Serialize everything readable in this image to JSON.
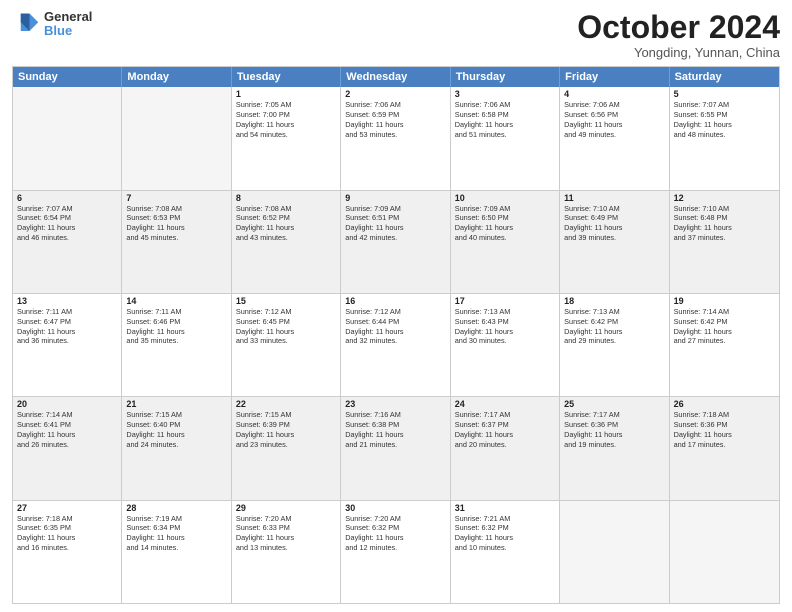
{
  "header": {
    "logo_line1": "General",
    "logo_line2": "Blue",
    "month": "October 2024",
    "location": "Yongding, Yunnan, China"
  },
  "weekdays": [
    "Sunday",
    "Monday",
    "Tuesday",
    "Wednesday",
    "Thursday",
    "Friday",
    "Saturday"
  ],
  "rows": [
    [
      {
        "day": "",
        "info": ""
      },
      {
        "day": "",
        "info": ""
      },
      {
        "day": "1",
        "info": "Sunrise: 7:05 AM\nSunset: 7:00 PM\nDaylight: 11 hours\nand 54 minutes."
      },
      {
        "day": "2",
        "info": "Sunrise: 7:06 AM\nSunset: 6:59 PM\nDaylight: 11 hours\nand 53 minutes."
      },
      {
        "day": "3",
        "info": "Sunrise: 7:06 AM\nSunset: 6:58 PM\nDaylight: 11 hours\nand 51 minutes."
      },
      {
        "day": "4",
        "info": "Sunrise: 7:06 AM\nSunset: 6:56 PM\nDaylight: 11 hours\nand 49 minutes."
      },
      {
        "day": "5",
        "info": "Sunrise: 7:07 AM\nSunset: 6:55 PM\nDaylight: 11 hours\nand 48 minutes."
      }
    ],
    [
      {
        "day": "6",
        "info": "Sunrise: 7:07 AM\nSunset: 6:54 PM\nDaylight: 11 hours\nand 46 minutes."
      },
      {
        "day": "7",
        "info": "Sunrise: 7:08 AM\nSunset: 6:53 PM\nDaylight: 11 hours\nand 45 minutes."
      },
      {
        "day": "8",
        "info": "Sunrise: 7:08 AM\nSunset: 6:52 PM\nDaylight: 11 hours\nand 43 minutes."
      },
      {
        "day": "9",
        "info": "Sunrise: 7:09 AM\nSunset: 6:51 PM\nDaylight: 11 hours\nand 42 minutes."
      },
      {
        "day": "10",
        "info": "Sunrise: 7:09 AM\nSunset: 6:50 PM\nDaylight: 11 hours\nand 40 minutes."
      },
      {
        "day": "11",
        "info": "Sunrise: 7:10 AM\nSunset: 6:49 PM\nDaylight: 11 hours\nand 39 minutes."
      },
      {
        "day": "12",
        "info": "Sunrise: 7:10 AM\nSunset: 6:48 PM\nDaylight: 11 hours\nand 37 minutes."
      }
    ],
    [
      {
        "day": "13",
        "info": "Sunrise: 7:11 AM\nSunset: 6:47 PM\nDaylight: 11 hours\nand 36 minutes."
      },
      {
        "day": "14",
        "info": "Sunrise: 7:11 AM\nSunset: 6:46 PM\nDaylight: 11 hours\nand 35 minutes."
      },
      {
        "day": "15",
        "info": "Sunrise: 7:12 AM\nSunset: 6:45 PM\nDaylight: 11 hours\nand 33 minutes."
      },
      {
        "day": "16",
        "info": "Sunrise: 7:12 AM\nSunset: 6:44 PM\nDaylight: 11 hours\nand 32 minutes."
      },
      {
        "day": "17",
        "info": "Sunrise: 7:13 AM\nSunset: 6:43 PM\nDaylight: 11 hours\nand 30 minutes."
      },
      {
        "day": "18",
        "info": "Sunrise: 7:13 AM\nSunset: 6:42 PM\nDaylight: 11 hours\nand 29 minutes."
      },
      {
        "day": "19",
        "info": "Sunrise: 7:14 AM\nSunset: 6:42 PM\nDaylight: 11 hours\nand 27 minutes."
      }
    ],
    [
      {
        "day": "20",
        "info": "Sunrise: 7:14 AM\nSunset: 6:41 PM\nDaylight: 11 hours\nand 26 minutes."
      },
      {
        "day": "21",
        "info": "Sunrise: 7:15 AM\nSunset: 6:40 PM\nDaylight: 11 hours\nand 24 minutes."
      },
      {
        "day": "22",
        "info": "Sunrise: 7:15 AM\nSunset: 6:39 PM\nDaylight: 11 hours\nand 23 minutes."
      },
      {
        "day": "23",
        "info": "Sunrise: 7:16 AM\nSunset: 6:38 PM\nDaylight: 11 hours\nand 21 minutes."
      },
      {
        "day": "24",
        "info": "Sunrise: 7:17 AM\nSunset: 6:37 PM\nDaylight: 11 hours\nand 20 minutes."
      },
      {
        "day": "25",
        "info": "Sunrise: 7:17 AM\nSunset: 6:36 PM\nDaylight: 11 hours\nand 19 minutes."
      },
      {
        "day": "26",
        "info": "Sunrise: 7:18 AM\nSunset: 6:36 PM\nDaylight: 11 hours\nand 17 minutes."
      }
    ],
    [
      {
        "day": "27",
        "info": "Sunrise: 7:18 AM\nSunset: 6:35 PM\nDaylight: 11 hours\nand 16 minutes."
      },
      {
        "day": "28",
        "info": "Sunrise: 7:19 AM\nSunset: 6:34 PM\nDaylight: 11 hours\nand 14 minutes."
      },
      {
        "day": "29",
        "info": "Sunrise: 7:20 AM\nSunset: 6:33 PM\nDaylight: 11 hours\nand 13 minutes."
      },
      {
        "day": "30",
        "info": "Sunrise: 7:20 AM\nSunset: 6:32 PM\nDaylight: 11 hours\nand 12 minutes."
      },
      {
        "day": "31",
        "info": "Sunrise: 7:21 AM\nSunset: 6:32 PM\nDaylight: 11 hours\nand 10 minutes."
      },
      {
        "day": "",
        "info": ""
      },
      {
        "day": "",
        "info": ""
      }
    ]
  ]
}
